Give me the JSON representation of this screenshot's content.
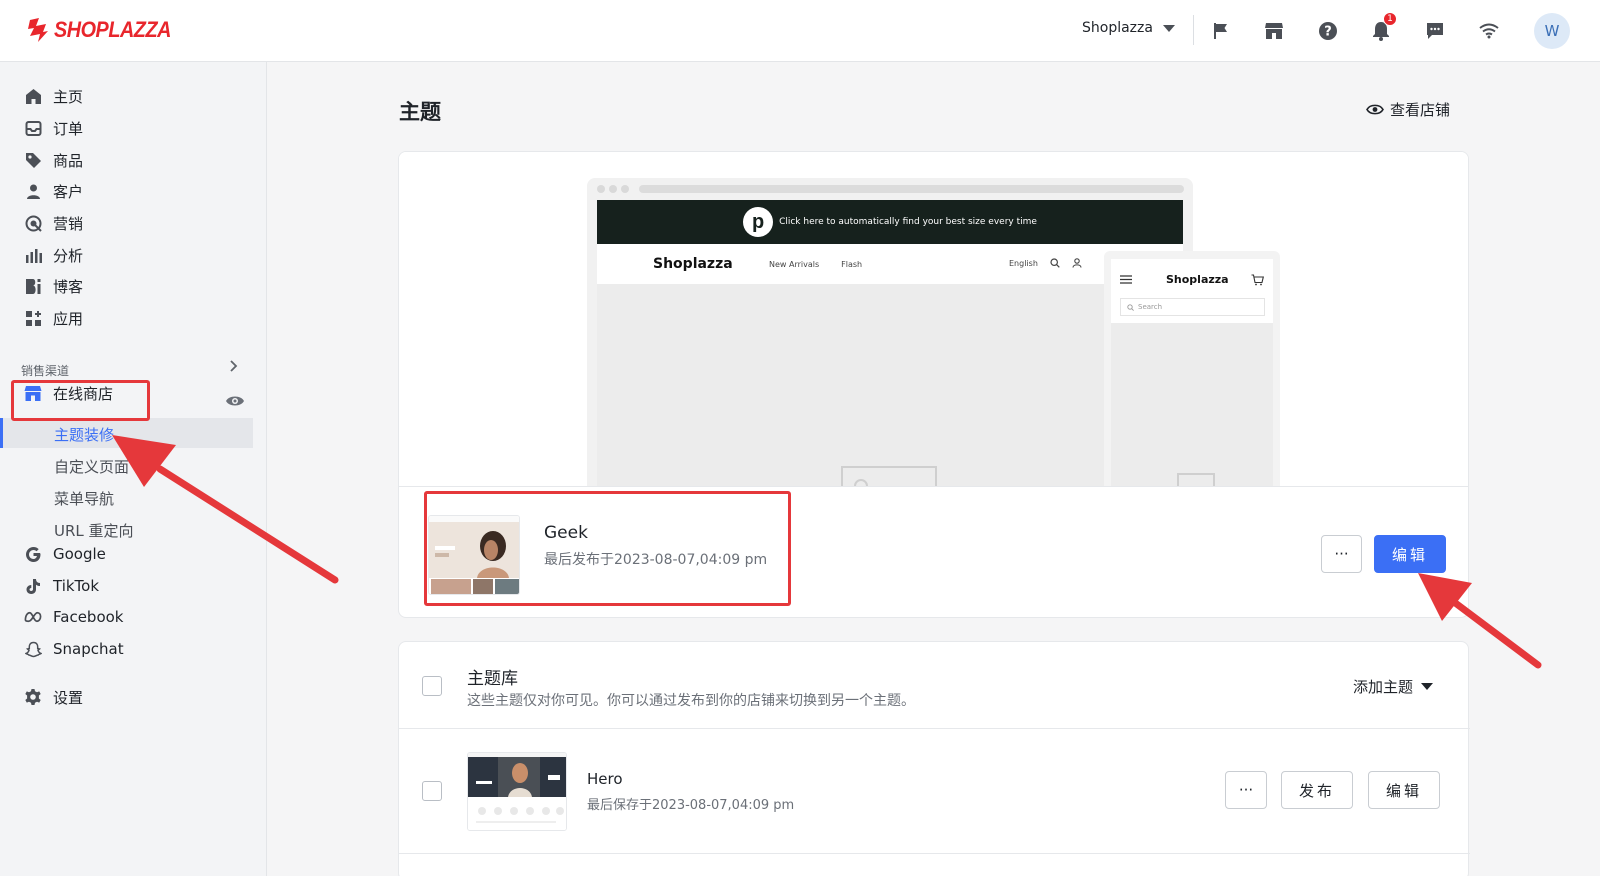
{
  "brand": {
    "logo_text": "SHOPLAZZA",
    "accent_color": "#e8262c",
    "primary_color": "#3b6ff5"
  },
  "topbar": {
    "store_name": "Shoplazza",
    "notification_count": "1",
    "avatar_initial": "W",
    "icons": [
      "flag-icon",
      "store-icon",
      "help-icon",
      "bell-icon",
      "chat-icon",
      "wifi-icon"
    ]
  },
  "sidebar": {
    "items": [
      {
        "label": "主页",
        "icon": "home-icon"
      },
      {
        "label": "订单",
        "icon": "inbox-icon"
      },
      {
        "label": "商品",
        "icon": "tag-icon"
      },
      {
        "label": "客户",
        "icon": "person-icon"
      },
      {
        "label": "营销",
        "icon": "target-icon"
      },
      {
        "label": "分析",
        "icon": "bar-chart-icon"
      },
      {
        "label": "博客",
        "icon": "blog-icon"
      },
      {
        "label": "应用",
        "icon": "apps-icon"
      }
    ],
    "section_label": "销售渠道",
    "online_store": "在线商店",
    "sub_items": [
      "主题装修",
      "自定义页面",
      "菜单导航",
      "URL 重定向"
    ],
    "channels": [
      {
        "label": "Google",
        "icon": "google-icon"
      },
      {
        "label": "TikTok",
        "icon": "tiktok-icon"
      },
      {
        "label": "Facebook",
        "icon": "meta-icon"
      },
      {
        "label": "Snapchat",
        "icon": "snapchat-icon"
      }
    ],
    "settings": "设置"
  },
  "main": {
    "title": "主题",
    "view_store": "查看店铺",
    "preview": {
      "announcement": "Click here to automatically find your best size every time",
      "site_brand": "Shoplazza",
      "nav_links": [
        "New Arrivals",
        "Flash"
      ],
      "language": "English",
      "mobile_brand": "Shoplazza",
      "mobile_search_placeholder": "Search"
    },
    "current_theme": {
      "name": "Geek",
      "meta": "最后发布于2023-08-07,04:09 pm",
      "more_label": "···",
      "edit_label": "编辑"
    },
    "library": {
      "title": "主题库",
      "description": "这些主题仅对你可见。你可以通过发布到你的店铺来切换到另一个主题。",
      "add_theme": "添加主题",
      "themes": [
        {
          "name": "Hero",
          "meta": "最后保存于2023-08-07,04:09 pm",
          "more_label": "···",
          "publish_label": "发布",
          "edit_label": "编辑"
        }
      ]
    }
  }
}
